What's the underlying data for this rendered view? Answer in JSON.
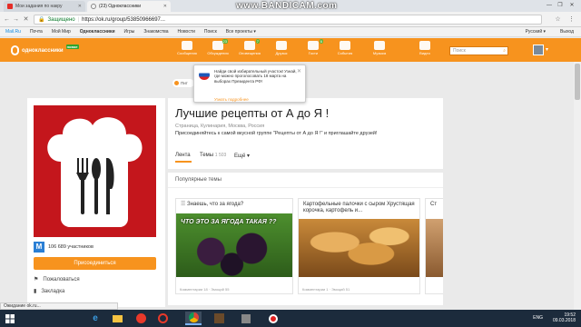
{
  "browser": {
    "tabs": [
      {
        "label": "Мои задания по накру",
        "color": "#e52d27"
      },
      {
        "label": "(23) Одноклассники",
        "color": "#f7931e"
      }
    ],
    "watermark": "www.BANDICAM.com",
    "secure_label": "Защищено",
    "url": "https://ok.ru/group/53850966697...",
    "status": "Ожидание ok.ru..."
  },
  "bookmarks": {
    "items": [
      "Mail.Ru",
      "Почта",
      "Мой Мир",
      "Одноклассники",
      "Игры",
      "Знакомства",
      "Новости",
      "Поиск",
      "Все проекты ▾"
    ],
    "lang": "Русский ▾",
    "exit": "Выход"
  },
  "ok": {
    "logo": "одноклассники",
    "logo_badge": "новое",
    "nav": [
      {
        "label": "Сообщения",
        "count": ""
      },
      {
        "label": "Обсуждения",
        "count": "23"
      },
      {
        "label": "Оповещения",
        "count": "7"
      },
      {
        "label": "Друзья",
        "count": ""
      },
      {
        "label": "Гости",
        "count": "6"
      },
      {
        "label": "События",
        "count": ""
      },
      {
        "label": "Музыка",
        "count": ""
      },
      {
        "label": "Видео",
        "count": ""
      }
    ],
    "search_placeholder": "Поиск"
  },
  "notification": {
    "text": "Найди свой избирательный участок! Узнай, где можно проголосовать 18 марта на выборах Президента РФ!",
    "link": "Узнать подробнее"
  },
  "chip": "Пит",
  "group": {
    "members_icon": "M",
    "members": "106 689 участников",
    "join": "Присоединиться",
    "complain": "Пожаловаться",
    "bookmark": "Закладка",
    "title": "Лучшие рецепты от А до Я !",
    "meta": "Страница, Кулинария, Москва, Россия",
    "invite": "Присоединяйтесь к самой вкусной группе \"Рецепты от А до Я !\" и приглашайте друзей!",
    "tabs": {
      "feed": "Лента",
      "topics": "Темы",
      "topics_count": "1 503",
      "more": "Ещё ▾"
    }
  },
  "popular": {
    "title": "Популярные темы",
    "cards": [
      {
        "title": "Знаешь, что за ягода?",
        "overlay": "ЧТО ЭТО ЗА ЯГОДА ТАКАЯ ??",
        "footer": "Комментарии 18 · Эмоций 55"
      },
      {
        "title": "Картофельные палочки с сыром Хрустящая корочка, картофель и...",
        "overlay": "",
        "footer": "Комментарии 1 · Эмоций 51"
      },
      {
        "title": "Ст",
        "overlay": "",
        "footer": ""
      }
    ]
  },
  "taskbar": {
    "lang": "ENG",
    "time": "19:52",
    "date": "09.03.2018"
  }
}
